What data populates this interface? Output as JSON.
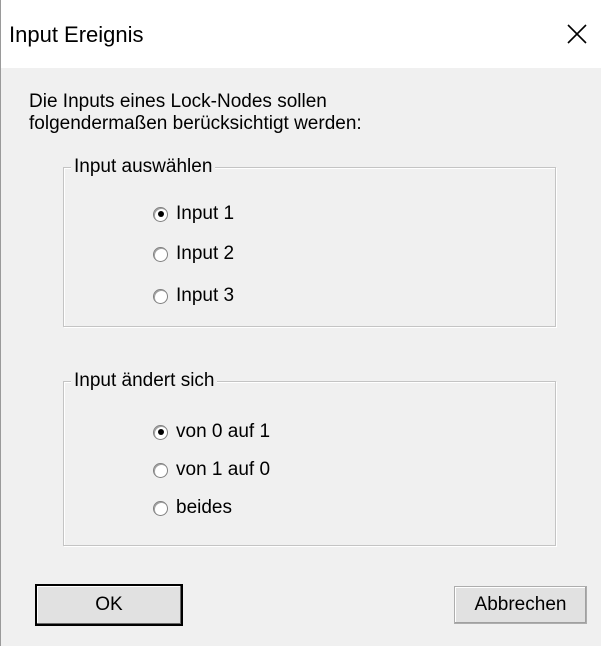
{
  "dialog": {
    "title": "Input Ereignis",
    "description_line1": "Die Inputs eines Lock-Nodes sollen",
    "description_line2": "folgendermaßen berücksichtigt werden:"
  },
  "group_input": {
    "legend": "Input auswählen",
    "selected": "Input 1",
    "options": [
      {
        "label": "Input 1",
        "checked": true
      },
      {
        "label": "Input 2",
        "checked": false
      },
      {
        "label": "Input 3",
        "checked": false
      }
    ]
  },
  "group_change": {
    "legend": "Input ändert sich",
    "selected": "von 0 auf 1",
    "options": [
      {
        "label": "von 0 auf 1",
        "checked": true
      },
      {
        "label": "von 1 auf 0",
        "checked": false
      },
      {
        "label": "beides",
        "checked": false
      }
    ]
  },
  "buttons": {
    "ok_label": "OK",
    "cancel_label": "Abbrechen"
  },
  "icons": {
    "close": "close-icon",
    "radio": "radio-button-icon"
  }
}
